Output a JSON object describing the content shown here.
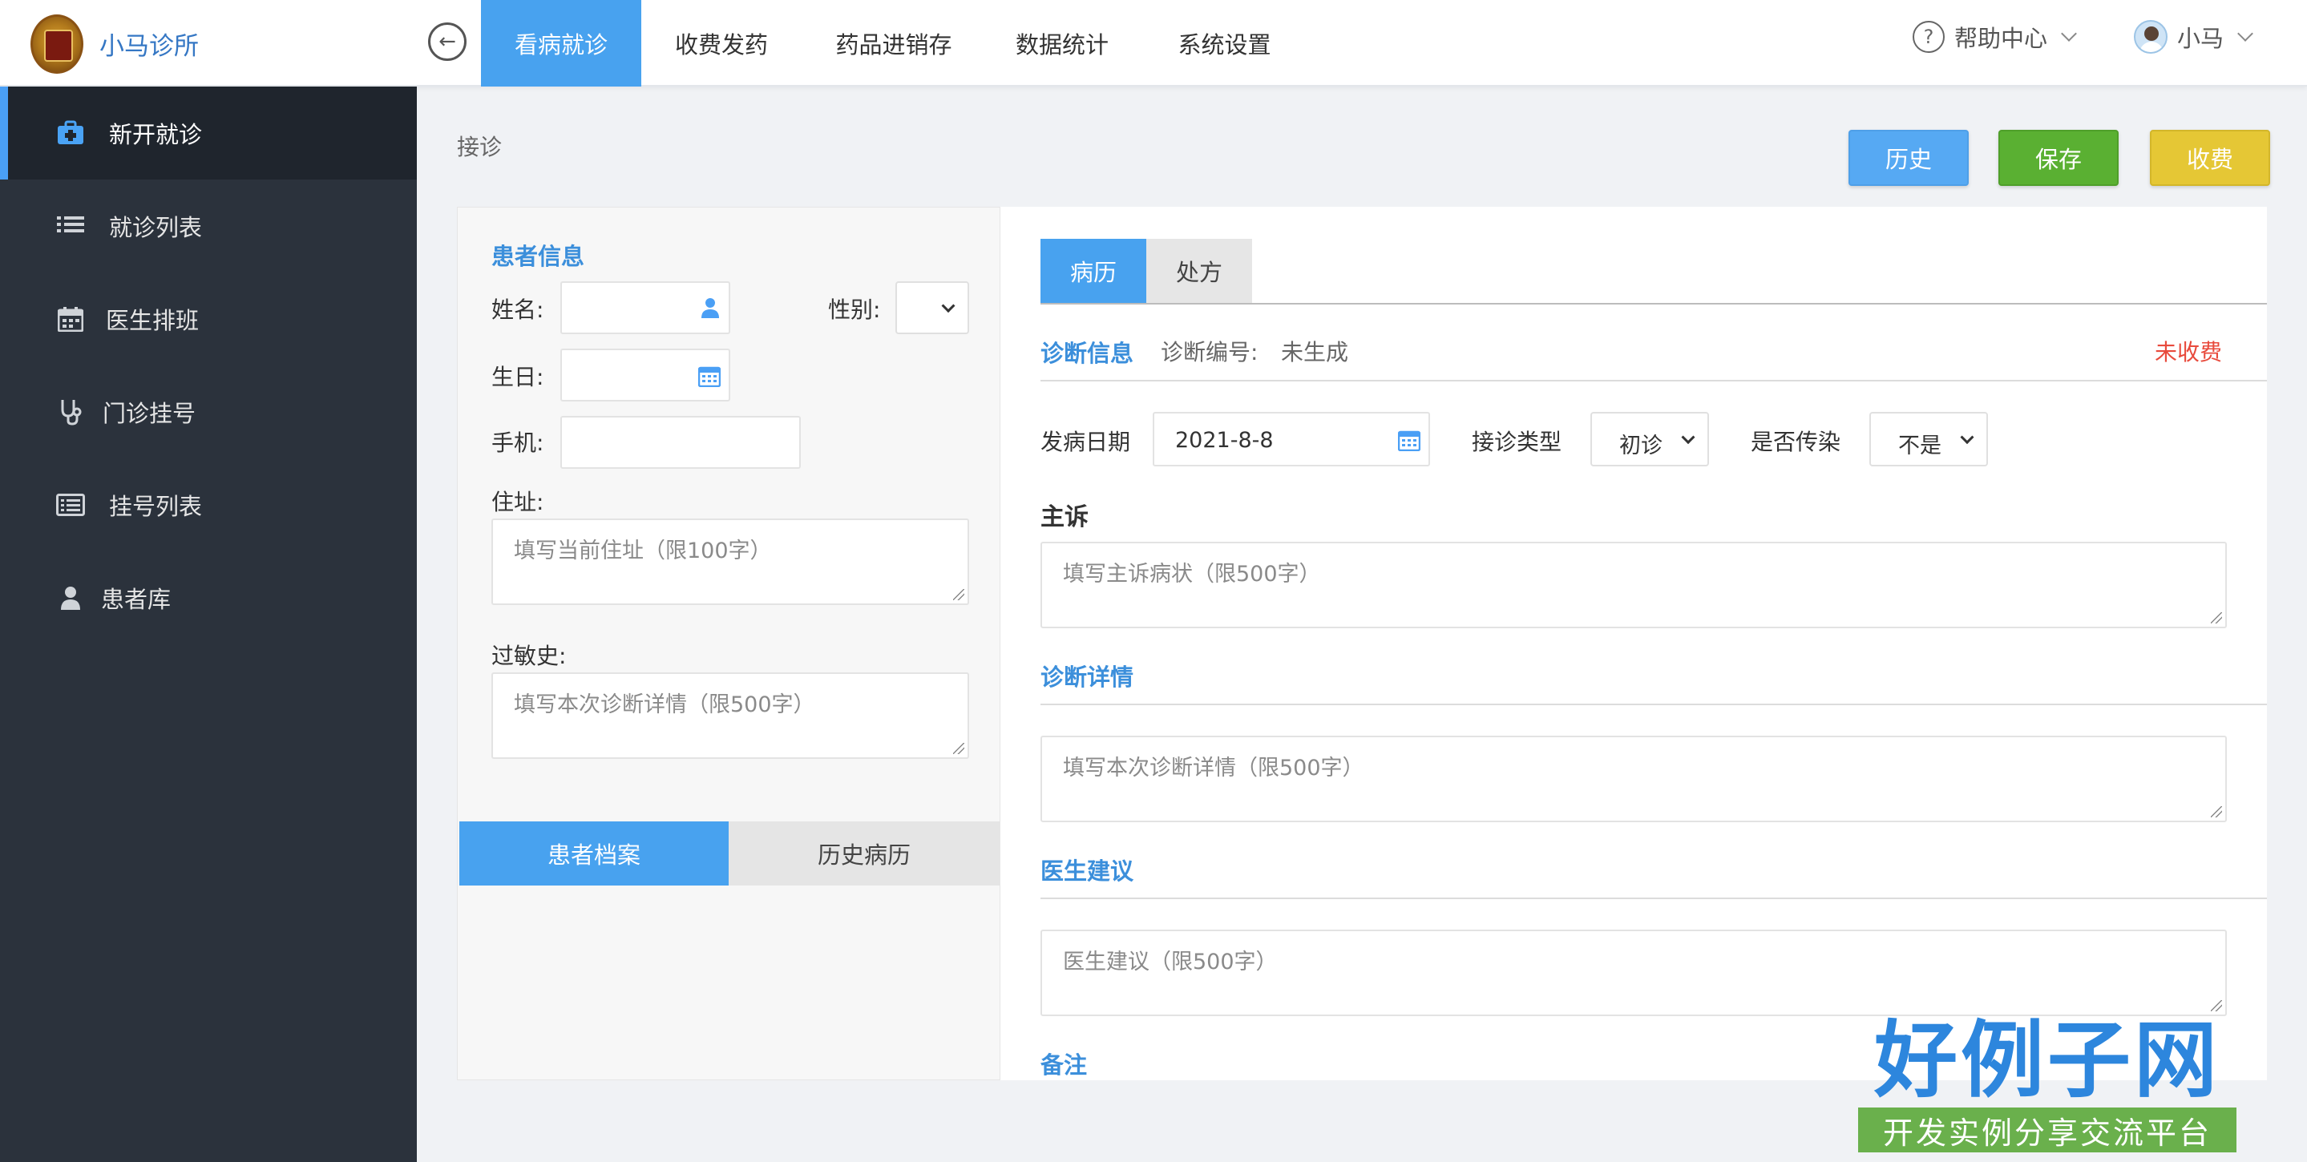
{
  "header": {
    "app_name": "小马诊所",
    "nav": [
      "看病就诊",
      "收费发药",
      "药品进销存",
      "数据统计",
      "系统设置"
    ],
    "help_label": "帮助中心",
    "user_name": "小马",
    "accent_color": "#48a2ef"
  },
  "sidebar": {
    "items": [
      {
        "label": "新开就诊",
        "icon": "medical-kit-icon"
      },
      {
        "label": "就诊列表",
        "icon": "list-icon"
      },
      {
        "label": "医生排班",
        "icon": "calendar-icon"
      },
      {
        "label": "门诊挂号",
        "icon": "stethoscope-icon"
      },
      {
        "label": "挂号列表",
        "icon": "registration-list-icon"
      },
      {
        "label": "患者库",
        "icon": "user-icon"
      }
    ]
  },
  "page": {
    "title": "接诊",
    "buttons": {
      "history": "历史",
      "save": "保存",
      "charge": "收费"
    }
  },
  "patient": {
    "section_title": "患者信息",
    "name_label": "姓名:",
    "gender_label": "性别:",
    "birthday_label": "生日:",
    "phone_label": "手机:",
    "address_label": "住址:",
    "address_placeholder": "填写当前住址（限100字）",
    "allergy_label": "过敏史:",
    "allergy_placeholder": "填写本次诊断详情（限500字）",
    "tabs": [
      "患者档案",
      "历史病历"
    ]
  },
  "record": {
    "tabs": [
      "病历",
      "处方"
    ],
    "diag_info_title": "诊断信息",
    "diag_no_label": "诊断编号:",
    "diag_no_value": "未生成",
    "charge_status": "未收费",
    "onset_label": "发病日期",
    "onset_value": "2021-8-8",
    "visit_type_label": "接诊类型",
    "visit_type_value": "初诊",
    "infectious_label": "是否传染",
    "infectious_value": "不是",
    "complaint_title": "主诉",
    "complaint_placeholder": "填写主诉病状（限500字）",
    "detail_title": "诊断详情",
    "detail_placeholder": "填写本次诊断详情（限500字）",
    "advice_title": "医生建议",
    "advice_placeholder": "医生建议（限500字）",
    "note_title": "备注"
  },
  "watermark": {
    "brand": "好例子网",
    "tagline": "开发实例分享交流平台"
  }
}
